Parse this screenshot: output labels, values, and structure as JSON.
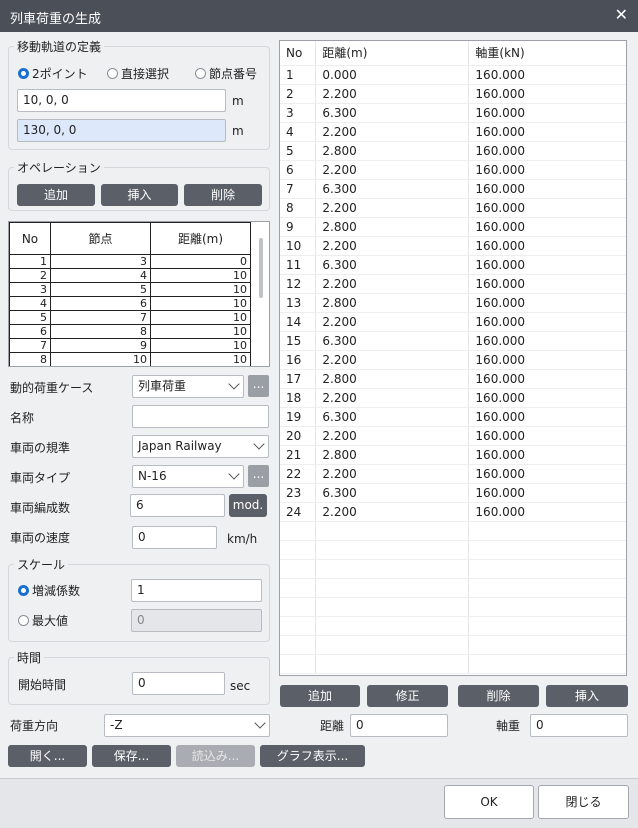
{
  "window": {
    "title": "列車荷重の生成"
  },
  "track": {
    "group_label": "移動軌道の定義",
    "radio_2point": "2ポイント",
    "radio_direct": "直接選択",
    "radio_node": "節点番号",
    "point1": "10, 0, 0",
    "point2": "130, 0, 0",
    "unit": "m"
  },
  "operation": {
    "group_label": "オペレーション",
    "add": "追加",
    "insert": "挿入",
    "delete": "削除"
  },
  "node_table": {
    "headers": [
      "No",
      "節点",
      "距離(m)"
    ],
    "rows": [
      [
        "1",
        "3",
        "0"
      ],
      [
        "2",
        "4",
        "10"
      ],
      [
        "3",
        "5",
        "10"
      ],
      [
        "4",
        "6",
        "10"
      ],
      [
        "5",
        "7",
        "10"
      ],
      [
        "6",
        "8",
        "10"
      ],
      [
        "7",
        "9",
        "10"
      ],
      [
        "8",
        "10",
        "10"
      ]
    ]
  },
  "form": {
    "load_case_label": "動的荷重ケース",
    "load_case_value": "列車荷重",
    "name_label": "名称",
    "name_value": "",
    "standard_label": "車両の規準",
    "standard_value": "Japan Railway",
    "type_label": "車両タイプ",
    "type_value": "N-16",
    "count_label": "車両編成数",
    "count_value": "6",
    "mod_label": "mod.",
    "speed_label": "車両の速度",
    "speed_value": "0",
    "speed_unit": "km/h",
    "ellipsis": "..."
  },
  "scale": {
    "group_label": "スケール",
    "factor_label": "増減係数",
    "factor_value": "1",
    "max_label": "最大値",
    "max_value": "0"
  },
  "time": {
    "group_label": "時間",
    "start_label": "開始時間",
    "start_value": "0",
    "unit": "sec"
  },
  "axle_table": {
    "headers": [
      "No",
      "距離(m)",
      "軸重(kN)"
    ],
    "rows": [
      [
        "1",
        "0.000",
        "160.000"
      ],
      [
        "2",
        "2.200",
        "160.000"
      ],
      [
        "3",
        "6.300",
        "160.000"
      ],
      [
        "4",
        "2.200",
        "160.000"
      ],
      [
        "5",
        "2.800",
        "160.000"
      ],
      [
        "6",
        "2.200",
        "160.000"
      ],
      [
        "7",
        "6.300",
        "160.000"
      ],
      [
        "8",
        "2.200",
        "160.000"
      ],
      [
        "9",
        "2.800",
        "160.000"
      ],
      [
        "10",
        "2.200",
        "160.000"
      ],
      [
        "11",
        "6.300",
        "160.000"
      ],
      [
        "12",
        "2.200",
        "160.000"
      ],
      [
        "13",
        "2.800",
        "160.000"
      ],
      [
        "14",
        "2.200",
        "160.000"
      ],
      [
        "15",
        "6.300",
        "160.000"
      ],
      [
        "16",
        "2.200",
        "160.000"
      ],
      [
        "17",
        "2.800",
        "160.000"
      ],
      [
        "18",
        "2.200",
        "160.000"
      ],
      [
        "19",
        "6.300",
        "160.000"
      ],
      [
        "20",
        "2.200",
        "160.000"
      ],
      [
        "21",
        "2.800",
        "160.000"
      ],
      [
        "22",
        "2.200",
        "160.000"
      ],
      [
        "23",
        "6.300",
        "160.000"
      ],
      [
        "24",
        "2.200",
        "160.000"
      ]
    ]
  },
  "axle_ops": {
    "add": "追加",
    "modify": "修正",
    "delete": "削除",
    "insert": "挿入"
  },
  "bottom": {
    "direction_label": "荷重方向",
    "direction_value": "-Z",
    "distance_label": "距離",
    "distance_value": "0",
    "axle_label": "軸重",
    "axle_value": "0",
    "open": "開く...",
    "save": "保存...",
    "load": "読込み...",
    "graph": "グラフ表示..."
  },
  "footer": {
    "ok": "OK",
    "close": "閉じる"
  }
}
